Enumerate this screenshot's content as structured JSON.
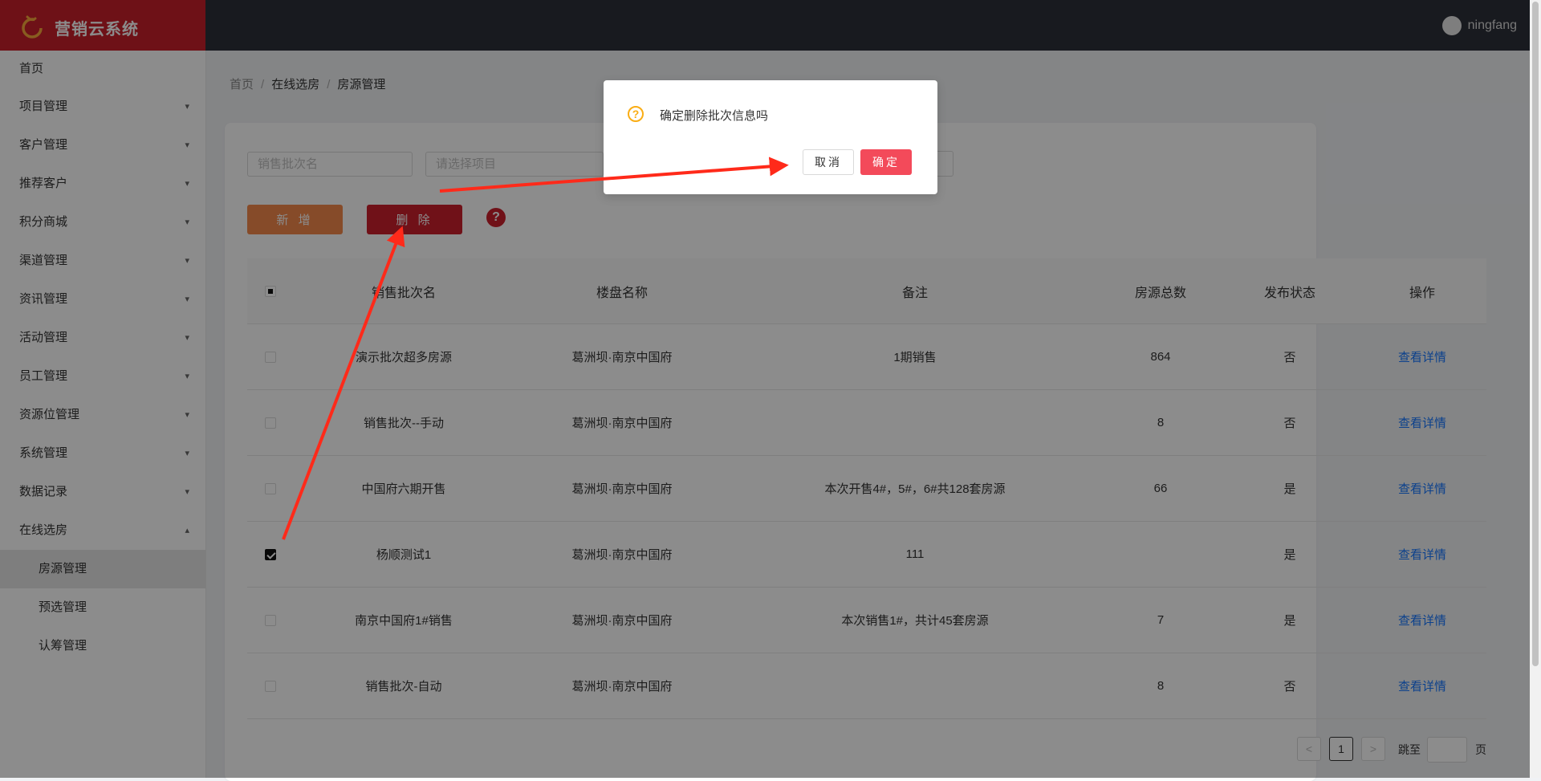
{
  "app": {
    "title": "营销云系统",
    "user": "ningfang"
  },
  "sidebar": {
    "home": "首页",
    "groups": [
      {
        "label": "项目管理"
      },
      {
        "label": "客户管理"
      },
      {
        "label": "推荐客户"
      },
      {
        "label": "积分商城"
      },
      {
        "label": "渠道管理"
      },
      {
        "label": "资讯管理"
      },
      {
        "label": "活动管理"
      },
      {
        "label": "员工管理"
      },
      {
        "label": "资源位管理"
      },
      {
        "label": "系统管理"
      },
      {
        "label": "数据记录"
      },
      {
        "label": "在线选房"
      }
    ],
    "subitems": [
      {
        "label": "房源管理",
        "active": true
      },
      {
        "label": "预选管理"
      },
      {
        "label": "认筹管理"
      }
    ]
  },
  "breadcrumb": {
    "items": [
      "首页",
      "在线选房",
      "房源管理"
    ]
  },
  "filters": {
    "batch_placeholder": "销售批次名",
    "project_placeholder": "请选择项目"
  },
  "toolbar": {
    "add_label": "新 增",
    "delete_label": "删 除",
    "help_label": "?"
  },
  "table": {
    "headers": [
      "销售批次名",
      "楼盘名称",
      "备注",
      "房源总数",
      "发布状态",
      "操作"
    ],
    "rows": [
      {
        "name": "演示批次超多房源",
        "estate": "葛洲坝·南京中国府",
        "remark": "1期销售",
        "total": "864",
        "status": "否",
        "op": "查看详情",
        "checked": false
      },
      {
        "name": "销售批次--手动",
        "estate": "葛洲坝·南京中国府",
        "remark": "",
        "total": "8",
        "status": "否",
        "op": "查看详情",
        "checked": false
      },
      {
        "name": "中国府六期开售",
        "estate": "葛洲坝·南京中国府",
        "remark": "本次开售4#，5#，6#共128套房源",
        "total": "66",
        "status": "是",
        "op": "查看详情",
        "checked": false
      },
      {
        "name": "杨顺测试1",
        "estate": "葛洲坝·南京中国府",
        "remark": "111",
        "total": "",
        "status": "是",
        "op": "查看详情",
        "checked": true
      },
      {
        "name": "南京中国府1#销售",
        "estate": "葛洲坝·南京中国府",
        "remark": "本次销售1#，共计45套房源",
        "total": "7",
        "status": "是",
        "op": "查看详情",
        "checked": false
      },
      {
        "name": "销售批次-自动",
        "estate": "葛洲坝·南京中国府",
        "remark": "",
        "total": "8",
        "status": "否",
        "op": "查看详情",
        "checked": false
      }
    ]
  },
  "pagination": {
    "current": "1",
    "jump_label": "跳至",
    "page_label": "页",
    "prev": "<",
    "next": ">"
  },
  "dialog": {
    "message": "确定删除批次信息吗",
    "cancel_label": "取消",
    "ok_label": "确定",
    "icon": "?"
  },
  "colors": {
    "brand": "#c9202b",
    "header": "#2d3039",
    "danger": "#cc1f2d",
    "add": "#f5894c",
    "ok": "#f34a5a",
    "link": "#1677ff",
    "warning": "#faad14",
    "annotation": "#ff2a1a"
  }
}
